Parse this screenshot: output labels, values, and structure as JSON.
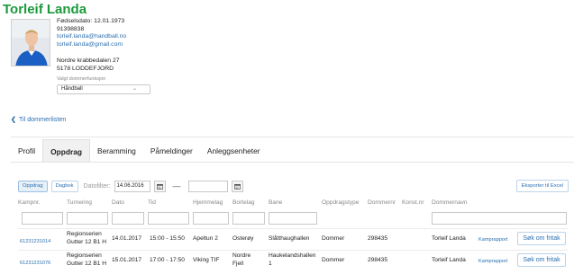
{
  "person": {
    "name": "Torleif Landa",
    "birthdate": "Fødselsdato: 12.01.1973",
    "phone": "91398838",
    "email1": "torleif.landa@handball.no",
    "email2": "torleif.landa@gmail.com",
    "address1": "Nordre krabbedalen 27",
    "address2": "5178 LODDEFJORD",
    "function_label": "Valgt dommerfunksjon",
    "function_value": "Håndball"
  },
  "nav": {
    "back_label": "Til dommerlisten"
  },
  "tabs": [
    {
      "label": "Profil"
    },
    {
      "label": "Oppdrag"
    },
    {
      "label": "Beramming"
    },
    {
      "label": "Påmeldinger"
    },
    {
      "label": "Anleggsenheter"
    }
  ],
  "toolbar": {
    "oppdrag_label": "Oppdrag",
    "dagbok_label": "Dagbok",
    "datofilter_label": "Datofilter:",
    "date_from": "14.06.2016",
    "date_to": "",
    "export_label": "Eksporter til Excel"
  },
  "table": {
    "headers": [
      "Kampnr.",
      "Turnering",
      "Dato",
      "Tid",
      "Hjemmelag",
      "Bortelag",
      "Bane",
      "Oppdragstype",
      "Dommernr",
      "Konst.nr",
      "Dommernavn"
    ],
    "rows": [
      {
        "kampnr": "61231231014",
        "turnering1": "Regionserien",
        "turnering2": "Gutter 12 B1 H",
        "dato": "14.01.2017",
        "tid": "15:00 - 15:50",
        "hjemmelag": "Apeltun 2",
        "bortelag": "Osterøy",
        "bane": "Slåtthaughallen",
        "oppdragstype": "Dommer",
        "dommernr": "298435",
        "dommernavn": "Torleif Landa",
        "rapport": "Kamprapport",
        "fritak": "Søk om fritak"
      },
      {
        "kampnr": "61231231076",
        "turnering1": "Regionserien",
        "turnering2": "Gutter 12 B1 H",
        "dato": "15.01.2017",
        "tid": "17:00 - 17:50",
        "hjemmelag": "Viking TIF",
        "bortelag1": "Nordre",
        "bortelag2": "Fjell",
        "bane1": "Haukelandshallen",
        "bane2": "1",
        "oppdragstype": "Dommer",
        "dommernr": "298435",
        "dommernavn": "Torleif Landa",
        "rapport": "Kamprapport",
        "fritak": "Søk om fritak"
      }
    ]
  },
  "colors": {
    "name_green": "#1a9a3a",
    "link_blue": "#2a6fb0"
  },
  "icons": {
    "back": "chevron-left-icon",
    "calendar": "calendar-icon",
    "select": "chevron-down-icon"
  }
}
